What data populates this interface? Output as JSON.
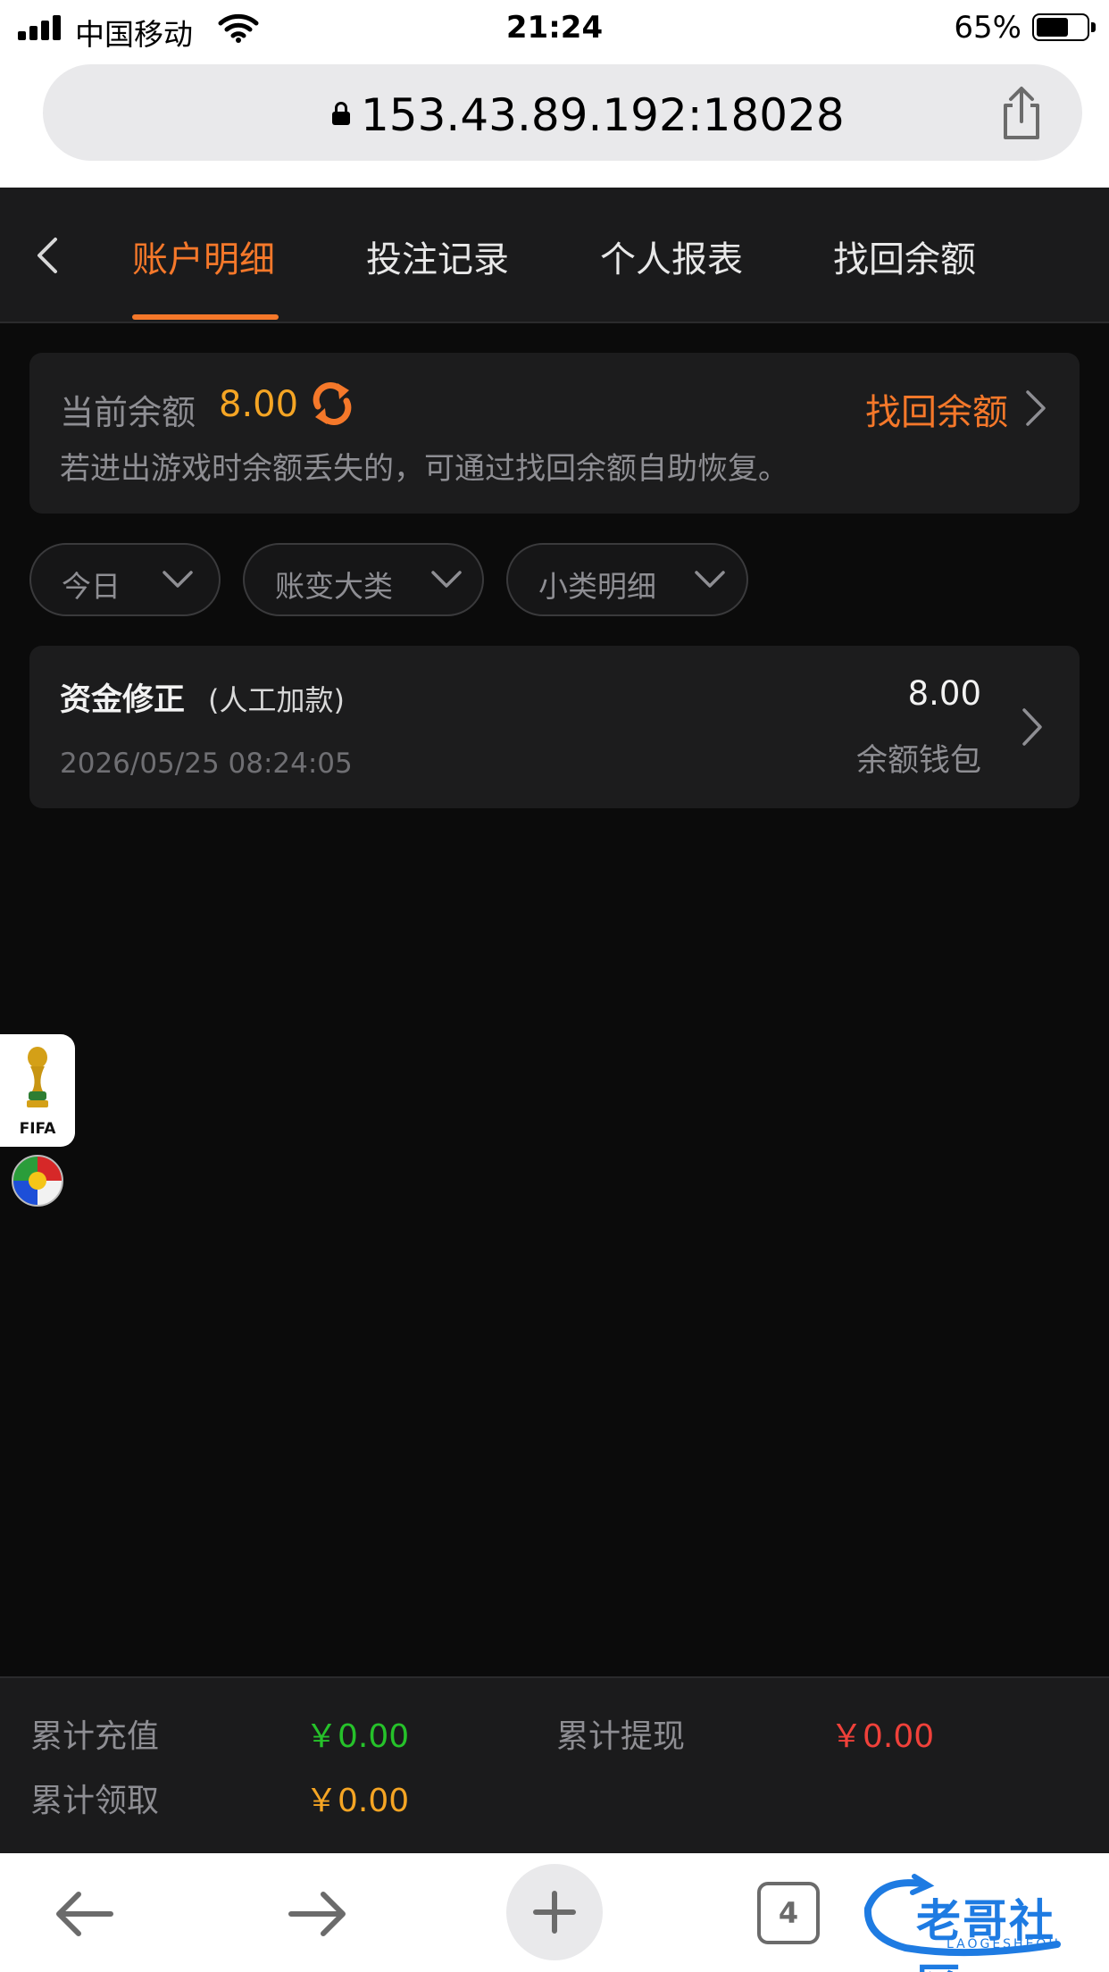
{
  "status_bar": {
    "carrier": "中国移动",
    "time": "21:24",
    "battery_percent": "65%",
    "battery_level": 0.65,
    "icons": [
      "signal-icon",
      "wifi-icon",
      "battery-icon"
    ]
  },
  "browser": {
    "url": "153.43.89.192:18028",
    "icons": [
      "lock-icon",
      "share-icon"
    ]
  },
  "tabs": [
    {
      "label": "账户明细",
      "active": true
    },
    {
      "label": "投注记录",
      "active": false
    },
    {
      "label": "个人报表",
      "active": false
    },
    {
      "label": "找回余额",
      "active": false
    }
  ],
  "balance": {
    "label": "当前余额",
    "value": "8.00",
    "recover_link": "找回余额",
    "hint": "若进出游戏时余额丢失的，可通过找回余额自助恢复。"
  },
  "filters": [
    {
      "label": "今日"
    },
    {
      "label": "账变大类"
    },
    {
      "label": "小类明细"
    }
  ],
  "records": [
    {
      "title": "资金修正",
      "subtitle": "(人工加款)",
      "time": "2026/05/25 08:24:05",
      "amount": "8.00",
      "wallet": "余额钱包"
    }
  ],
  "floating": {
    "fifa_text": "FIFA"
  },
  "totals": {
    "recharge_label": "累计充值",
    "recharge_value": "￥0.00",
    "withdraw_label": "累计提现",
    "withdraw_value": "￥0.00",
    "claim_label": "累计领取",
    "claim_value": "￥0.00"
  },
  "toolbar": {
    "tab_count": "4",
    "watermark_text": "老哥社区",
    "watermark_sub": "LAOGESHEQU"
  },
  "colors": {
    "accent": "#f5782a",
    "balance": "#f5a524",
    "positive": "#26c22a",
    "negative": "#f0413a",
    "background": "#0b0b0b"
  }
}
